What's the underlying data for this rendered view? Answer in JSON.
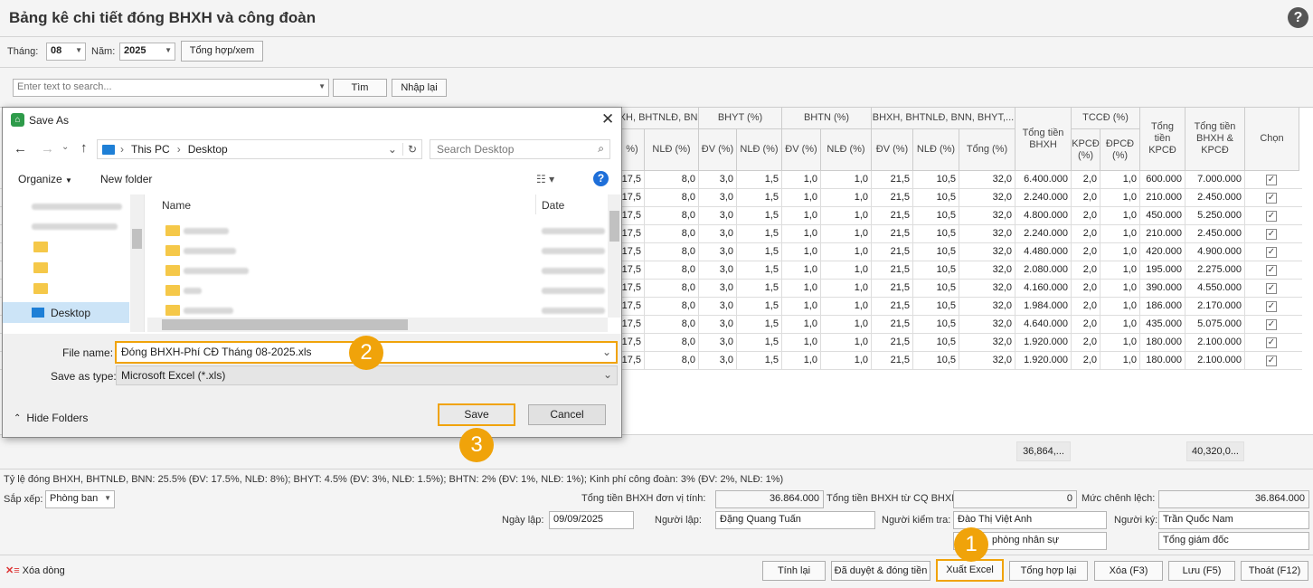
{
  "title": "Bảng kê chi tiết đóng BHXH và công đoàn",
  "filter": {
    "month_label": "Tháng:",
    "month": "08",
    "year_label": "Năm:",
    "year": "2025",
    "btn": "Tổng hợp/xem"
  },
  "search": {
    "placeholder": "Enter text to search...",
    "find": "Tìm",
    "reset": "Nhập lại"
  },
  "headers": {
    "g_bhxh": "BHXH, BHTNLĐ, BNN...",
    "g_bhyt": "BHYT (%)",
    "g_bhtn": "BHTN (%)",
    "g_total": "BHXH, BHTNLĐ, BNN, BHYT,...",
    "dv_pct": "ĐV (%)",
    "nld_pct": "NLĐ (%)",
    "tong_pct": "Tổng (%)",
    "pct": "%)",
    "tong_tien_bhxh": "Tổng tiền BHXH",
    "g_tccd": "TCCĐ (%)",
    "kpcd": "KPCĐ (%)",
    "dpcd": "ĐPCĐ (%)",
    "tong_tien_kpcd": "Tổng tiền KPCĐ",
    "tong_bhxh_kpcd": "Tổng tiền BHXH & KPCĐ",
    "chon": "Chọn"
  },
  "rows": [
    {
      "a": "17,5",
      "b": "8,0",
      "c": "3,0",
      "d": "1,5",
      "e": "1,0",
      "f": "1,0",
      "g": "21,5",
      "h": "10,5",
      "i": "32,0",
      "j": "6.400.000",
      "k": "2,0",
      "l": "1,0",
      "m": "600.000",
      "n": "7.000.000"
    },
    {
      "a": "17,5",
      "b": "8,0",
      "c": "3,0",
      "d": "1,5",
      "e": "1,0",
      "f": "1,0",
      "g": "21,5",
      "h": "10,5",
      "i": "32,0",
      "j": "2.240.000",
      "k": "2,0",
      "l": "1,0",
      "m": "210.000",
      "n": "2.450.000"
    },
    {
      "a": "17,5",
      "b": "8,0",
      "c": "3,0",
      "d": "1,5",
      "e": "1,0",
      "f": "1,0",
      "g": "21,5",
      "h": "10,5",
      "i": "32,0",
      "j": "4.800.000",
      "k": "2,0",
      "l": "1,0",
      "m": "450.000",
      "n": "5.250.000"
    },
    {
      "a": "17,5",
      "b": "8,0",
      "c": "3,0",
      "d": "1,5",
      "e": "1,0",
      "f": "1,0",
      "g": "21,5",
      "h": "10,5",
      "i": "32,0",
      "j": "2.240.000",
      "k": "2,0",
      "l": "1,0",
      "m": "210.000",
      "n": "2.450.000"
    },
    {
      "a": "17,5",
      "b": "8,0",
      "c": "3,0",
      "d": "1,5",
      "e": "1,0",
      "f": "1,0",
      "g": "21,5",
      "h": "10,5",
      "i": "32,0",
      "j": "4.480.000",
      "k": "2,0",
      "l": "1,0",
      "m": "420.000",
      "n": "4.900.000"
    },
    {
      "a": "17,5",
      "b": "8,0",
      "c": "3,0",
      "d": "1,5",
      "e": "1,0",
      "f": "1,0",
      "g": "21,5",
      "h": "10,5",
      "i": "32,0",
      "j": "2.080.000",
      "k": "2,0",
      "l": "1,0",
      "m": "195.000",
      "n": "2.275.000"
    },
    {
      "a": "17,5",
      "b": "8,0",
      "c": "3,0",
      "d": "1,5",
      "e": "1,0",
      "f": "1,0",
      "g": "21,5",
      "h": "10,5",
      "i": "32,0",
      "j": "4.160.000",
      "k": "2,0",
      "l": "1,0",
      "m": "390.000",
      "n": "4.550.000"
    },
    {
      "a": "17,5",
      "b": "8,0",
      "c": "3,0",
      "d": "1,5",
      "e": "1,0",
      "f": "1,0",
      "g": "21,5",
      "h": "10,5",
      "i": "32,0",
      "j": "1.984.000",
      "k": "2,0",
      "l": "1,0",
      "m": "186.000",
      "n": "2.170.000"
    },
    {
      "a": "17,5",
      "b": "8,0",
      "c": "3,0",
      "d": "1,5",
      "e": "1,0",
      "f": "1,0",
      "g": "21,5",
      "h": "10,5",
      "i": "32,0",
      "j": "4.640.000",
      "k": "2,0",
      "l": "1,0",
      "m": "435.000",
      "n": "5.075.000"
    },
    {
      "a": "17,5",
      "b": "8,0",
      "c": "3,0",
      "d": "1,5",
      "e": "1,0",
      "f": "1,0",
      "g": "21,5",
      "h": "10,5",
      "i": "32,0",
      "j": "1.920.000",
      "k": "2,0",
      "l": "1,0",
      "m": "180.000",
      "n": "2.100.000"
    },
    {
      "a": "17,5",
      "b": "8,0",
      "c": "3,0",
      "d": "1,5",
      "e": "1,0",
      "f": "1,0",
      "g": "21,5",
      "h": "10,5",
      "i": "32,0",
      "j": "1.920.000",
      "k": "2,0",
      "l": "1,0",
      "m": "180.000",
      "n": "2.100.000"
    }
  ],
  "summary": {
    "bhxh": "36,864,...",
    "total": "40,320,0..."
  },
  "note": "Tỷ lệ đóng BHXH, BHTNLĐ, BNN: 25.5% (ĐV: 17.5%, NLĐ: 8%); BHYT: 4.5% (ĐV: 3%, NLĐ: 1.5%); BHTN: 2% (ĐV: 1%, NLĐ: 1%); Kinh phí công đoàn: 3% (ĐV: 2%, NLĐ: 1%)",
  "sort": {
    "label": "Sắp xếp:",
    "value": "Phòng ban"
  },
  "totals": {
    "unit_label": "Tổng tiền BHXH đơn vị tính:",
    "unit_value": "36.864.000",
    "agency_label": "Tổng tiền BHXH từ CQ BHXH:",
    "agency_value": "0",
    "diff_label": "Mức chênh lệch:",
    "diff_value": "36.864.000"
  },
  "sign": {
    "date_label": "Ngày lập:",
    "date": "09/09/2025",
    "maker_label": "Người lập:",
    "maker": "Đặng Quang Tuấn",
    "checker_label": "Người kiểm tra:",
    "checker": "Đào Thị Việt Anh",
    "checker_title": "phòng nhân sự",
    "signer_label": "Người ký:",
    "signer": "Trần Quốc Nam",
    "signer_title": "Tổng giám đốc"
  },
  "footer": {
    "delete_row": "Xóa dòng",
    "recalc": "Tính lại",
    "approved": "Đã duyệt & đóng tiền",
    "export": "Xuất Excel",
    "resum": "Tổng hợp lại",
    "del": "Xóa (F3)",
    "save": "Lưu (F5)",
    "exit": "Thoát (F12)"
  },
  "dialog": {
    "title": "Save As",
    "path": [
      "This PC",
      "Desktop"
    ],
    "search_placeholder": "Search Desktop",
    "organize": "Organize",
    "new_folder": "New folder",
    "col_name": "Name",
    "col_date": "Date",
    "nav_selected": "Desktop",
    "file_name_label": "File name:",
    "file_name": "Đóng BHXH-Phí CĐ Tháng 08-2025.xls",
    "type_label": "Save as type:",
    "type": "Microsoft Excel (*.xls)",
    "hide_folders": "Hide Folders",
    "save": "Save",
    "cancel": "Cancel"
  },
  "badges": {
    "b1": "1",
    "b2": "2",
    "b3": "3"
  },
  "colors": {
    "highlight": "#f0a30a"
  }
}
